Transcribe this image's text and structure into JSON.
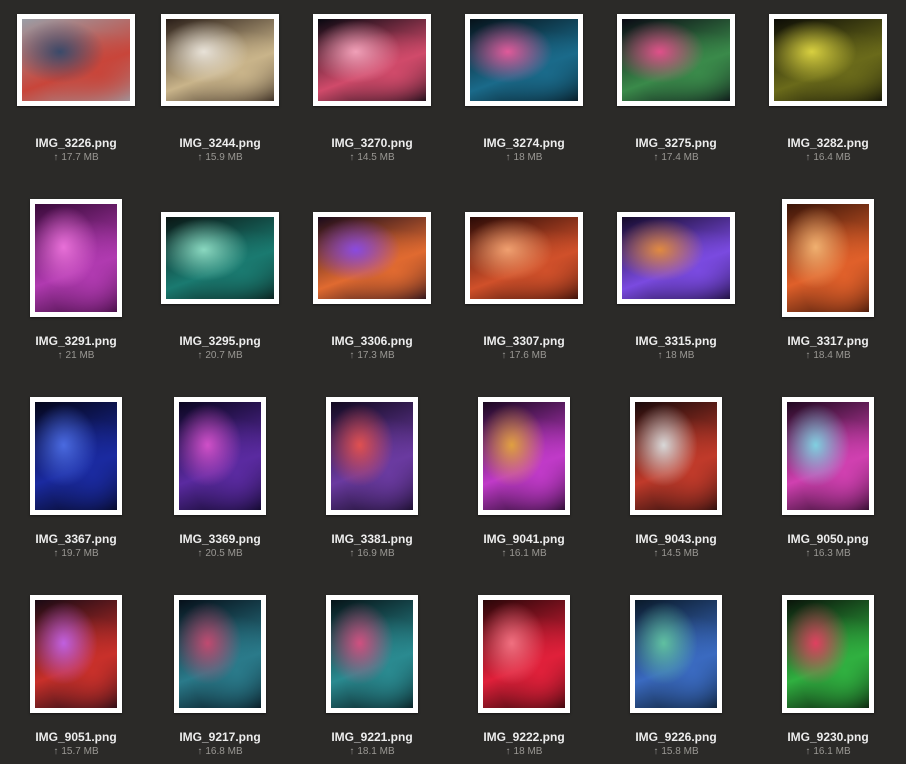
{
  "upload_glyph": "↑",
  "files": [
    {
      "name": "IMG_3226.png",
      "size": "17.7 MB",
      "orientation": "landscape",
      "palette": [
        "#9a9ea6",
        "#c8453a",
        "#3a4a6a"
      ]
    },
    {
      "name": "IMG_3244.png",
      "size": "15.9 MB",
      "orientation": "landscape",
      "palette": [
        "#2a1e18",
        "#c9b48a",
        "#e8e2d8"
      ]
    },
    {
      "name": "IMG_3270.png",
      "size": "14.5 MB",
      "orientation": "landscape",
      "palette": [
        "#080810",
        "#d04a6a",
        "#f0a0b8"
      ]
    },
    {
      "name": "IMG_3274.png",
      "size": "18 MB",
      "orientation": "landscape",
      "palette": [
        "#06121a",
        "#1a6a8a",
        "#e05a9a"
      ]
    },
    {
      "name": "IMG_3275.png",
      "size": "17.4 MB",
      "orientation": "landscape",
      "palette": [
        "#0a0a14",
        "#3a8a4a",
        "#e0508a"
      ]
    },
    {
      "name": "IMG_3282.png",
      "size": "16.4 MB",
      "orientation": "landscape",
      "palette": [
        "#0c0c06",
        "#6a6a1a",
        "#d8d040"
      ]
    },
    {
      "name": "IMG_3291.png",
      "size": "21 MB",
      "orientation": "portrait",
      "palette": [
        "#3a0a3a",
        "#b03ab0",
        "#e870d8"
      ]
    },
    {
      "name": "IMG_3295.png",
      "size": "20.7 MB",
      "orientation": "landscape",
      "palette": [
        "#0a1614",
        "#1a7a70",
        "#8ad8c0"
      ]
    },
    {
      "name": "IMG_3306.png",
      "size": "17.3 MB",
      "orientation": "landscape",
      "palette": [
        "#1a0a1a",
        "#e06a30",
        "#8a4ae0"
      ]
    },
    {
      "name": "IMG_3307.png",
      "size": "17.6 MB",
      "orientation": "landscape",
      "palette": [
        "#2a0a06",
        "#d0502a",
        "#f0a070"
      ]
    },
    {
      "name": "IMG_3315.png",
      "size": "18 MB",
      "orientation": "landscape",
      "palette": [
        "#140a2a",
        "#7a4ae0",
        "#e08a40"
      ]
    },
    {
      "name": "IMG_3317.png",
      "size": "18.4 MB",
      "orientation": "portrait",
      "palette": [
        "#3a1408",
        "#e0602a",
        "#f0b070"
      ]
    },
    {
      "name": "IMG_3367.png",
      "size": "19.7 MB",
      "orientation": "portrait",
      "palette": [
        "#04061a",
        "#1a2aa0",
        "#4a6ae0"
      ]
    },
    {
      "name": "IMG_3369.png",
      "size": "20.5 MB",
      "orientation": "portrait",
      "palette": [
        "#0a0620",
        "#5a2aa0",
        "#d050c8"
      ]
    },
    {
      "name": "IMG_3381.png",
      "size": "16.9 MB",
      "orientation": "portrait",
      "palette": [
        "#120a20",
        "#6a3aa0",
        "#e05050"
      ]
    },
    {
      "name": "IMG_9041.png",
      "size": "16.1 MB",
      "orientation": "portrait",
      "palette": [
        "#1a0820",
        "#c03ac8",
        "#e0a040"
      ]
    },
    {
      "name": "IMG_9043.png",
      "size": "14.5 MB",
      "orientation": "portrait",
      "palette": [
        "#1a0a0a",
        "#c03a2a",
        "#d8d8d8"
      ]
    },
    {
      "name": "IMG_9050.png",
      "size": "16.3 MB",
      "orientation": "portrait",
      "palette": [
        "#200820",
        "#d040b0",
        "#80d0e0"
      ]
    },
    {
      "name": "IMG_9051.png",
      "size": "15.7 MB",
      "orientation": "portrait",
      "palette": [
        "#1a0a14",
        "#c8302a",
        "#c060e0"
      ]
    },
    {
      "name": "IMG_9217.png",
      "size": "16.8 MB",
      "orientation": "portrait",
      "palette": [
        "#06101a",
        "#2a7a8a",
        "#c04a70"
      ]
    },
    {
      "name": "IMG_9221.png",
      "size": "18.1 MB",
      "orientation": "portrait",
      "palette": [
        "#061418",
        "#2a8a90",
        "#d05080"
      ]
    },
    {
      "name": "IMG_9222.png",
      "size": "18 MB",
      "orientation": "portrait",
      "palette": [
        "#2a0608",
        "#e0203a",
        "#f07080"
      ]
    },
    {
      "name": "IMG_9226.png",
      "size": "15.8 MB",
      "orientation": "portrait",
      "palette": [
        "#0a1a2a",
        "#3a6ac0",
        "#60c0a0"
      ]
    },
    {
      "name": "IMG_9230.png",
      "size": "16.1 MB",
      "orientation": "portrait",
      "palette": [
        "#0a140a",
        "#30b040",
        "#e04060"
      ]
    }
  ]
}
